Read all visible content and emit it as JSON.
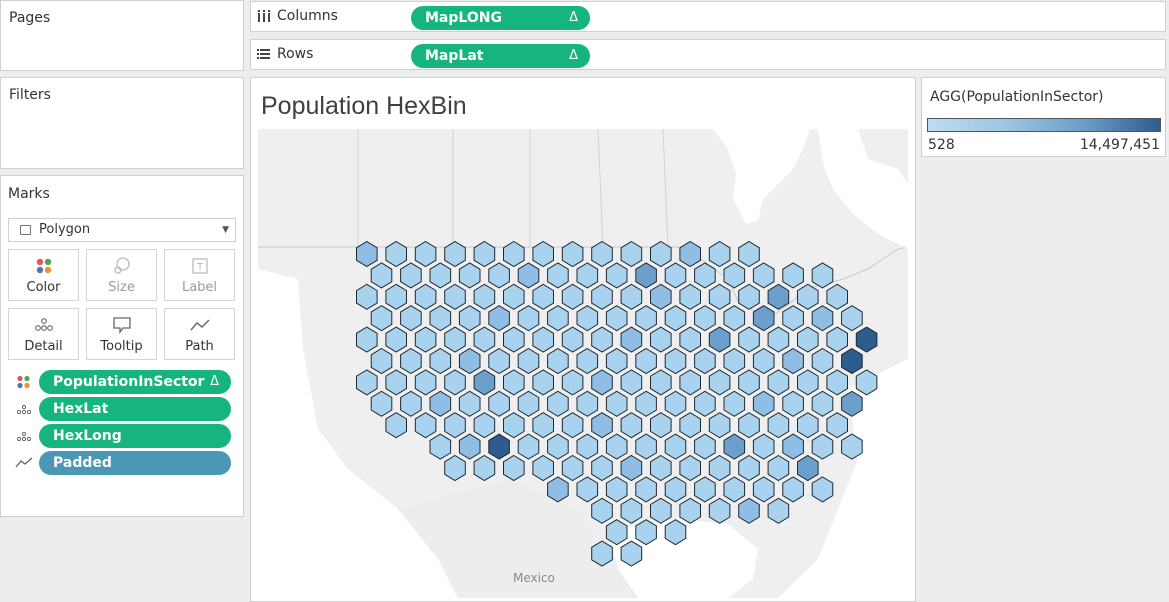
{
  "left_panel": {
    "pages_title": "Pages",
    "filters_title": "Filters",
    "marks_title": "Marks",
    "mark_type": "Polygon",
    "buttons": {
      "color": "Color",
      "size": "Size",
      "label": "Label",
      "detail": "Detail",
      "tooltip": "Tooltip",
      "path": "Path"
    },
    "fields": [
      {
        "name": "PopulationInSector",
        "delta": "Δ",
        "role": "color"
      },
      {
        "name": "HexLat",
        "role": "detail"
      },
      {
        "name": "HexLong",
        "role": "detail"
      },
      {
        "name": "Padded",
        "role": "path"
      }
    ]
  },
  "shelves": {
    "columns_label": "Columns",
    "columns_pill": "MapLONG",
    "rows_label": "Rows",
    "rows_pill": "MapLat",
    "delta": "Δ"
  },
  "viz": {
    "title": "Population HexBin",
    "map_label": "Mexico"
  },
  "legend": {
    "title": "AGG(PopulationInSector)",
    "min_label": "528",
    "max_label": "14,497,451",
    "color_low": "#bcdcf2",
    "color_high": "#2d5d8e"
  },
  "colors": {
    "pill_green": "#16b57f",
    "pill_blue": "#4a97b6",
    "hex_base": "#a9d2ee",
    "hex_mid": "#8fbde3",
    "hex_dark": "#6d9fcc",
    "hex_darkest": "#2d5d8e"
  }
}
